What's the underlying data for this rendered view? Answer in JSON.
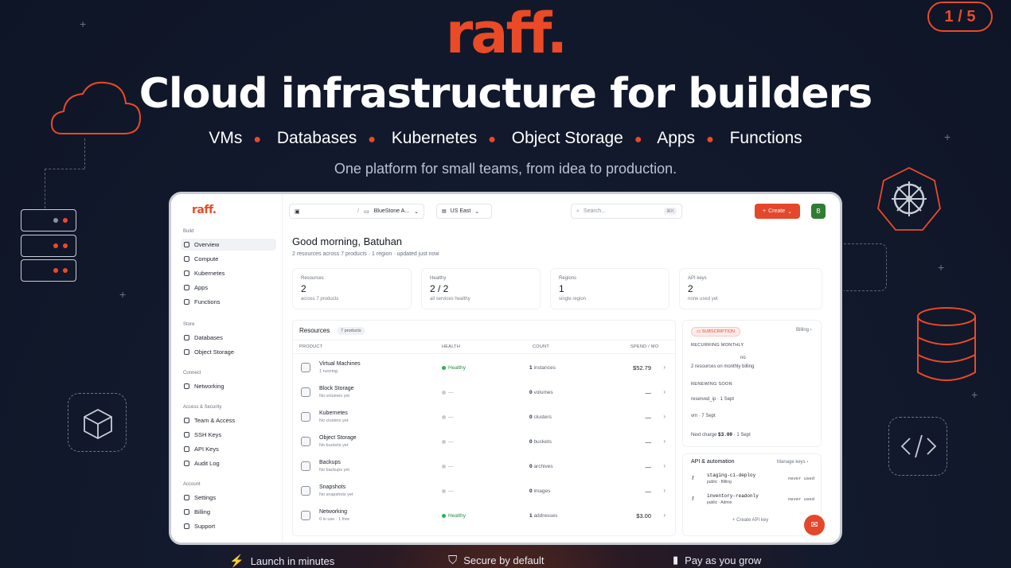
{
  "hero": {
    "logo": "raff.",
    "page_indicator": "1 / 5",
    "headline": "Cloud infrastructure for builders",
    "products": [
      "VMs",
      "Databases",
      "Kubernetes",
      "Object Storage",
      "Apps",
      "Functions"
    ],
    "tagline": "One platform for small teams, from idea to production."
  },
  "features": [
    {
      "icon": "bolt-icon",
      "label": "Launch in minutes"
    },
    {
      "icon": "shield-check-icon",
      "label": "Secure by default"
    },
    {
      "icon": "bar-chart-icon",
      "label": "Pay as you grow"
    }
  ],
  "app": {
    "logo": "raff.",
    "topbar": {
      "org": "BlueStone A...",
      "region": "US East",
      "search_placeholder": "Search...",
      "search_shortcut": "⌘K",
      "create_label": "Create",
      "avatar": "B"
    },
    "sidebar": {
      "build_label": "Build",
      "build": [
        "Overview",
        "Compute",
        "Kubernetes",
        "Apps",
        "Functions"
      ],
      "store_label": "Store",
      "store": [
        "Databases",
        "Object Storage"
      ],
      "connect_label": "Connect",
      "connect": [
        "Networking"
      ],
      "access_label": "Access & Security",
      "access": [
        "Team & Access",
        "SSH Keys",
        "API Keys",
        "Audit Log"
      ],
      "account_label": "Account",
      "account": [
        "Settings",
        "Billing",
        "Support"
      ]
    },
    "greeting": "Good morning, Batuhan",
    "greeting_sub": "2 resources across 7 products · 1 region · updated just now",
    "stats": [
      {
        "label": "Resources",
        "value": "2",
        "sub": "across 7 products"
      },
      {
        "label": "Healthy",
        "value": "2 / 2",
        "sub": "all services healthy"
      },
      {
        "label": "Regions",
        "value": "1",
        "sub": "single region"
      },
      {
        "label": "API keys",
        "value": "2",
        "sub": "none used yet"
      }
    ],
    "resources": {
      "title": "Resources",
      "count_badge": "7 products",
      "columns": [
        "PRODUCT",
        "HEALTH",
        "COUNT",
        "SPEND / MO"
      ],
      "rows": [
        {
          "name": "Virtual Machines",
          "sub": "1 running",
          "health": "Healthy",
          "count": "1",
          "unit": "instances",
          "spend": "$52.79"
        },
        {
          "name": "Block Storage",
          "sub": "No volumes yet",
          "health": "—",
          "count": "0",
          "unit": "volumes",
          "spend": "—"
        },
        {
          "name": "Kubernetes",
          "sub": "No clusters yet",
          "health": "—",
          "count": "0",
          "unit": "clusters",
          "spend": "—"
        },
        {
          "name": "Object Storage",
          "sub": "No buckets yet",
          "health": "—",
          "count": "0",
          "unit": "buckets",
          "spend": "—"
        },
        {
          "name": "Backups",
          "sub": "No backups yet",
          "health": "—",
          "count": "0",
          "unit": "archives",
          "spend": "—"
        },
        {
          "name": "Snapshots",
          "sub": "No snapshots yet",
          "health": "—",
          "count": "0",
          "unit": "images",
          "spend": "—"
        },
        {
          "name": "Networking",
          "sub": "0 in use · 1 free",
          "health": "Healthy",
          "count": "1",
          "unit": "addresses",
          "spend": "$3.00"
        }
      ]
    },
    "subscription": {
      "badge": "SUBSCRIPTION",
      "billing_link": "Billing",
      "recurring_label": "RECURRING MONTHLY",
      "recurring_value": "no",
      "recurring_sub": "2 resources on monthly billing",
      "renewing_label": "RENEWING SOON",
      "renewing_1": "reserved_ip · 1 Sept",
      "renewing_2": "vm · 7 Sept",
      "next_charge_prefix": "Next charge",
      "next_charge_amount": "$3.00",
      "next_charge_date": "· 1 Sept"
    },
    "api": {
      "title": "API & automation",
      "manage_link": "Manage keys",
      "keys": [
        {
          "name": "staging-ci-deploy",
          "meta": "public · Billing",
          "status": "never used"
        },
        {
          "name": "inventory-readonly",
          "meta": "public · Admin",
          "status": "never used"
        }
      ],
      "create_label": "Create API key"
    }
  }
}
